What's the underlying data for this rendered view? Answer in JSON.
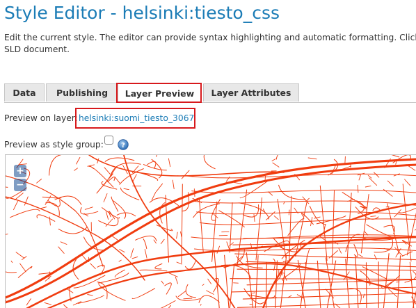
{
  "page": {
    "title": "Style Editor - helsinki:tiesto_css",
    "description": "Edit the current style. The editor can provide syntax highlighting and automatic formatting. Click SLD document."
  },
  "tabs": [
    {
      "label": "Data"
    },
    {
      "label": "Publishing"
    },
    {
      "label": "Layer Preview"
    },
    {
      "label": "Layer Attributes"
    }
  ],
  "preview": {
    "layer_label": "Preview on layer:",
    "layer_name": "helsinki:suomi_tiesto_3067",
    "group_label": "Preview as style group:",
    "group_checked": false
  },
  "map": {
    "zoom_in": "+",
    "zoom_out": "−",
    "road_color": "#f03c0f"
  },
  "colors": {
    "accent": "#1b7cb6",
    "highlight": "#d7191c"
  }
}
